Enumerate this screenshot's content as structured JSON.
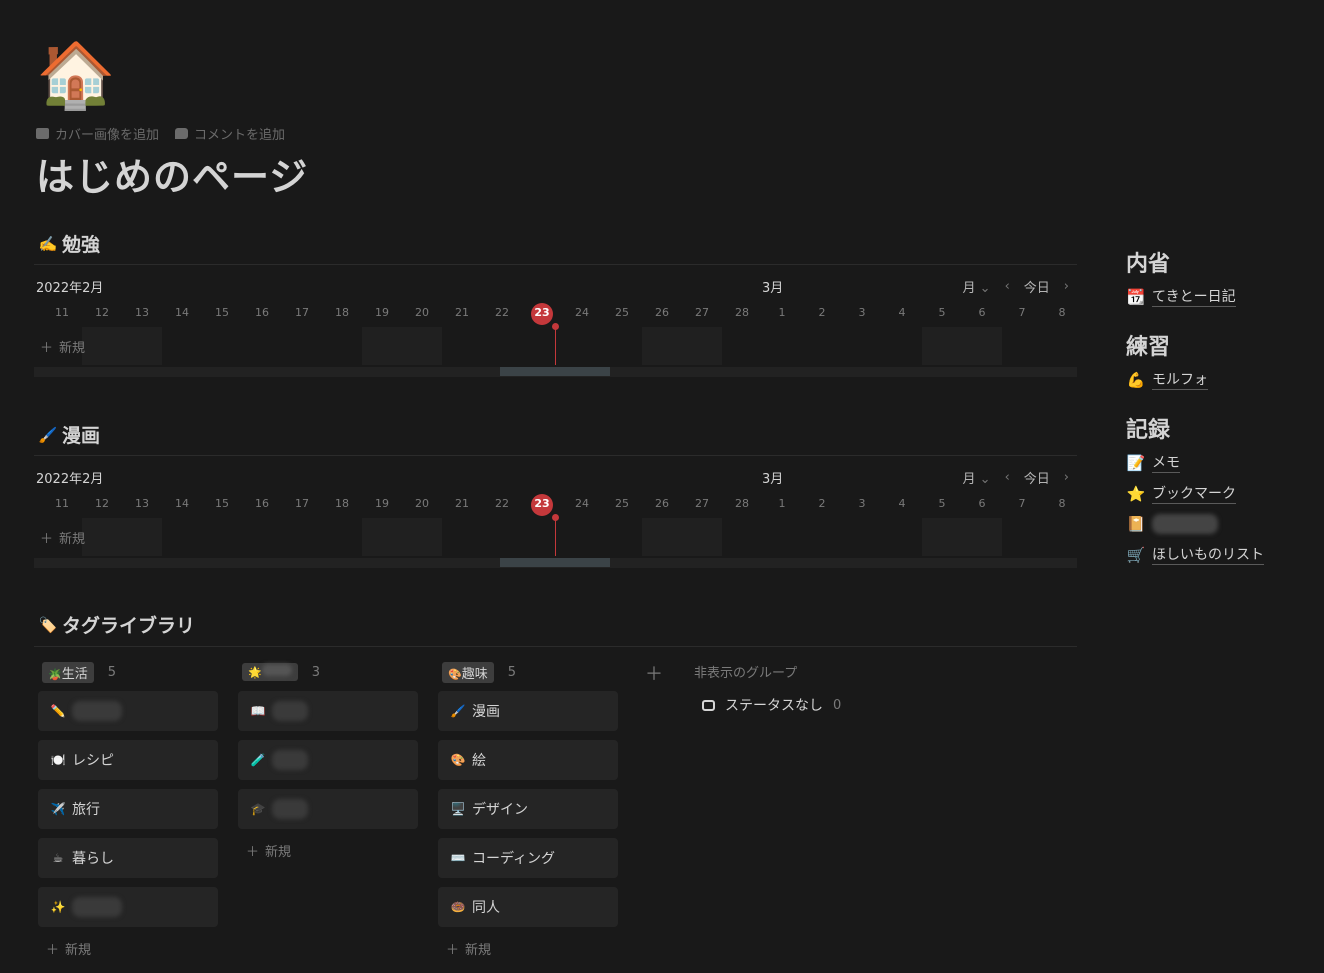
{
  "page": {
    "icon": "🏠",
    "add_cover": "カバー画像を追加",
    "add_comment": "コメントを追加",
    "title": "はじめのページ"
  },
  "timelines": [
    {
      "heading_icon": "✍️",
      "heading": "勉強",
      "month_left": "2022年2月",
      "month_right": "3月",
      "view": "月",
      "today": "今日",
      "days": [
        "11",
        "12",
        "13",
        "14",
        "15",
        "16",
        "17",
        "18",
        "19",
        "20",
        "21",
        "22",
        "23",
        "24",
        "25",
        "26",
        "27",
        "28",
        "1",
        "2",
        "3",
        "4",
        "5",
        "6",
        "7",
        "8"
      ],
      "today_day": "23",
      "new": "新規"
    },
    {
      "heading_icon": "🖌️",
      "heading": "漫画",
      "month_left": "2022年2月",
      "month_right": "3月",
      "view": "月",
      "today": "今日",
      "days": [
        "11",
        "12",
        "13",
        "14",
        "15",
        "16",
        "17",
        "18",
        "19",
        "20",
        "21",
        "22",
        "23",
        "24",
        "25",
        "26",
        "27",
        "28",
        "1",
        "2",
        "3",
        "4",
        "5",
        "6",
        "7",
        "8"
      ],
      "today_day": "23",
      "new": "新規"
    }
  ],
  "tag_library": {
    "heading_icon": "🏷️",
    "heading": "タグライブラリ",
    "columns": [
      {
        "tag": "生活",
        "tag_icon": "🪴",
        "count": "5",
        "cards": [
          {
            "icon": "✏️",
            "label": ""
          },
          {
            "icon": "🍽️",
            "label": "レシピ"
          },
          {
            "icon": "✈️",
            "label": "旅行"
          },
          {
            "icon": "☕",
            "label": "暮らし"
          },
          {
            "icon": "✨",
            "label": ""
          }
        ]
      },
      {
        "tag": "",
        "tag_icon": "🌟",
        "count": "3",
        "cards": [
          {
            "icon": "📖",
            "label": ""
          },
          {
            "icon": "🧪",
            "label": ""
          },
          {
            "icon": "🎓",
            "label": ""
          }
        ]
      },
      {
        "tag": "趣味",
        "tag_icon": "🎨",
        "count": "5",
        "cards": [
          {
            "icon": "🖌️",
            "label": "漫画"
          },
          {
            "icon": "🎨",
            "label": "絵"
          },
          {
            "icon": "🖥️",
            "label": "デザイン"
          },
          {
            "icon": "⌨️",
            "label": "コーディング"
          },
          {
            "icon": "🍩",
            "label": "同人"
          }
        ]
      }
    ],
    "new": "新規",
    "hidden_groups": "非表示のグループ",
    "no_status": "ステータスなし",
    "no_status_count": "0"
  },
  "sidebar": {
    "groups": [
      {
        "title": "内省",
        "links": [
          {
            "icon": "📆",
            "label": "てきとー日記"
          }
        ]
      },
      {
        "title": "練習",
        "links": [
          {
            "icon": "💪",
            "label": "モルフォ"
          }
        ]
      },
      {
        "title": "記録",
        "links": [
          {
            "icon": "📝",
            "label": "メモ"
          },
          {
            "icon": "⭐",
            "label": "ブックマーク"
          },
          {
            "icon": "📔",
            "label": ""
          },
          {
            "icon": "🛒",
            "label": "ほしいものリスト"
          }
        ]
      }
    ]
  },
  "colors": {
    "background": "#191919",
    "today_red": "#c4383b",
    "card": "#252525"
  }
}
